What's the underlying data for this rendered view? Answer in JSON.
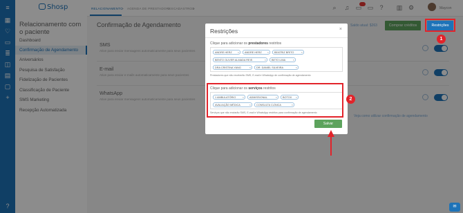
{
  "app": {
    "logo": "Shosp",
    "username": "Maycon"
  },
  "nav_rail": {
    "icons": [
      "menu-icon",
      "grid-icon",
      "heart-icon",
      "cash-icon",
      "database-icon",
      "briefcase-icon",
      "calendar-icon",
      "monitor-icon",
      "add-icon",
      "help-icon"
    ]
  },
  "sidebar": {
    "title": "Relacionamento com o paciente",
    "items": [
      {
        "label": "Dashboard"
      },
      {
        "label": "Confirmação de Agendamento"
      },
      {
        "label": "Aniversários"
      },
      {
        "label": "Pesquisa de Satisfação"
      },
      {
        "label": "Fidelização de Pacientes"
      },
      {
        "label": "Classificação de Paciente"
      },
      {
        "label": "SMS Marketing"
      },
      {
        "label": "Recepção Automatizada"
      }
    ]
  },
  "topbar": {
    "breadcrumbs": [
      "RELACIONAMENTO",
      "AGENDA DE PRESTADORES",
      "CADASTROS"
    ],
    "separator": ">"
  },
  "page": {
    "title": "Confirmação de Agendamento",
    "saldo": "Saldo atual: $263",
    "buy_credits": "Comprar créditos",
    "restrictions": "Restrições",
    "sections": [
      {
        "title": "SMS",
        "desc": "Ative para enviar mensagens automaticamente para seus pacientes"
      },
      {
        "title": "E-mail",
        "desc": "Ative para enviar e-mails automaticamente para seus pacientes"
      },
      {
        "title": "WhatsApp",
        "desc": "Ative para enviar mensagens automaticamente para seus pacientes"
      }
    ],
    "help_link": "Veja como utilizar confirmação de agendamento"
  },
  "modal": {
    "title": "Restrições",
    "close": "×",
    "providers_label_pre": "Clique para adicionar os ",
    "providers_label_bold": "prestadores",
    "providers_label_post": " restritos",
    "providers": [
      "ANDRE HERZ",
      "ANDRE HERZ",
      "BEATRIZ BRITO",
      "BENTO OLIVER ALMADA REIS",
      "BETO LIMA",
      "DRA CRISTINA YANG",
      "DR. DANIEL SILVEIRA"
    ],
    "providers_hint": "Prestadores que não receberão SMS, E-mail e WhatsApp de confirmação de agendamento",
    "services_label_pre": "Clique para adicionar os ",
    "services_label_bold": "serviços",
    "services_label_post": " restritos",
    "services": [
      "1 AMBULATÓRIO",
      "ADMISSIONAL",
      "BOTOX",
      "AVALIAÇÃO MÉDICA",
      "CONSULTA CLÍNICA"
    ],
    "services_hint": "Serviços que não enviarão SMS, E-mail e WhatsApp restritos para confirmação de agendamento",
    "save": "Salvar"
  },
  "annotations": {
    "step1": "1",
    "step2": "2",
    "accent": "#e2232a"
  },
  "colors": {
    "primary": "#1e73b8",
    "green": "#5da35d"
  }
}
